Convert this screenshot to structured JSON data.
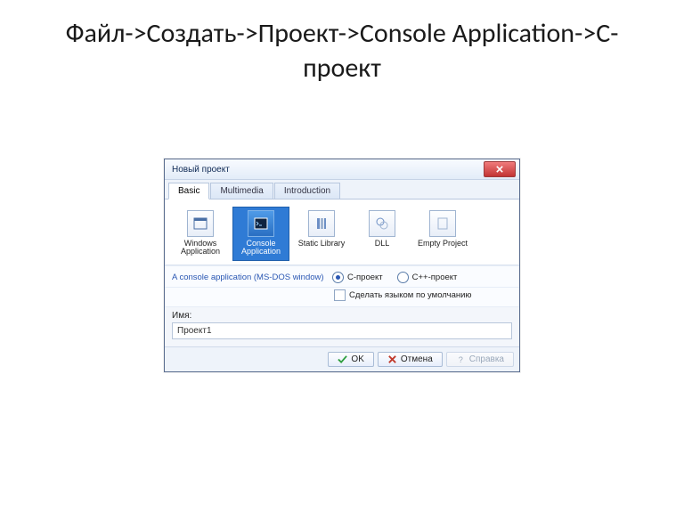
{
  "heading": "Файл->Создать->Проект->Console Application->C-проект",
  "dialog": {
    "title": "Новый проект",
    "tabs": [
      "Basic",
      "Multimedia",
      "Introduction"
    ],
    "project_types": [
      "Windows Application",
      "Console Application",
      "Static Library",
      "DLL",
      "Empty Project"
    ],
    "selected_project_type": "Console Application",
    "description": "A console application (MS-DOS window)",
    "radios": [
      "C-проект",
      "C++-проект"
    ],
    "selected_radio": "C-проект",
    "default_lang_label": "Сделать языком по умолчанию",
    "default_lang_checked": false,
    "name_label": "Имя:",
    "name_value": "Проект1",
    "buttons": {
      "ok": "OK",
      "cancel": "Отмена",
      "help": "Справка"
    }
  }
}
